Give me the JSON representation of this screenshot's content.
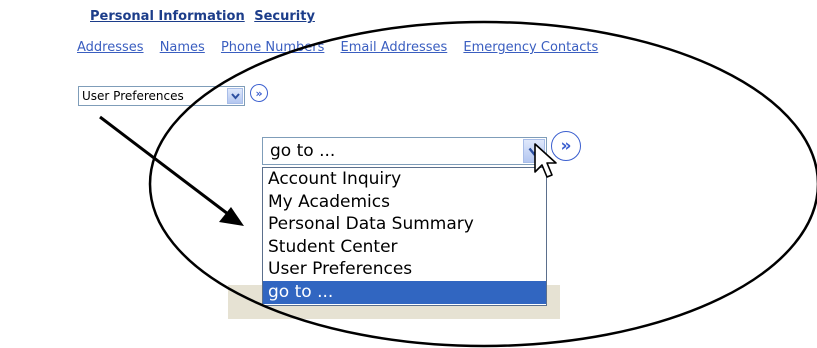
{
  "nav": {
    "primary": [
      {
        "label": "Personal Information"
      },
      {
        "label": "Security"
      }
    ],
    "secondary": [
      {
        "label": "Addresses"
      },
      {
        "label": "Names"
      },
      {
        "label": "Phone Numbers"
      },
      {
        "label": "Email Addresses"
      },
      {
        "label": "Emergency Contacts"
      }
    ]
  },
  "top_select": {
    "value": "User Preferences"
  },
  "goto_select": {
    "value": "go to ...",
    "options": [
      {
        "label": "Account Inquiry"
      },
      {
        "label": "My Academics"
      },
      {
        "label": "Personal Data Summary"
      },
      {
        "label": "Student Center"
      },
      {
        "label": "User Preferences"
      },
      {
        "label": "go to ...",
        "selected": true
      }
    ]
  },
  "colors": {
    "link": "#3a5ec0",
    "selection": "#3166c1",
    "annotation": "#000000"
  },
  "icons": [
    "chevron-down-icon",
    "double-chevron-right-icon",
    "mouse-pointer-icon",
    "arrow-icon"
  ]
}
